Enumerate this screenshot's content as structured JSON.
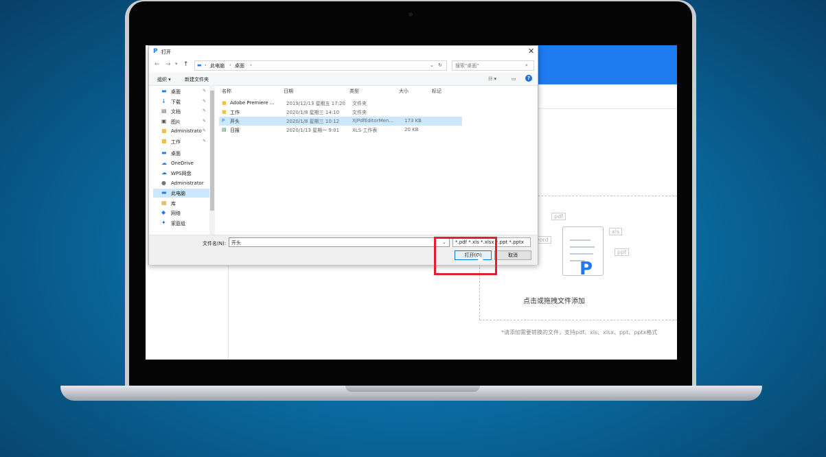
{
  "dialog": {
    "title": "打开",
    "breadcrumb": [
      "此电脑",
      "桌面"
    ],
    "search_placeholder": "搜索\"桌面\"",
    "commands": {
      "organize": "组织 ▾",
      "new_folder": "新建文件夹"
    },
    "nav_items": [
      {
        "icon": "desktop-icon",
        "label": "桌面",
        "pinned": true
      },
      {
        "icon": "download-icon",
        "label": "下载",
        "pinned": true
      },
      {
        "icon": "document-icon",
        "label": "文档",
        "pinned": true
      },
      {
        "icon": "image-icon",
        "label": "图片",
        "pinned": true
      },
      {
        "icon": "folder-icon",
        "label": "Administrato",
        "pinned": true
      },
      {
        "icon": "folder-icon",
        "label": "工作",
        "pinned": true
      },
      {
        "icon": "desktop-icon",
        "label": "桌面",
        "pinned": false
      },
      {
        "icon": "cloud-icon",
        "label": "OneDrive",
        "pinned": false
      },
      {
        "icon": "cloud-icon",
        "label": "WPS网盘",
        "pinned": false
      },
      {
        "icon": "user-icon",
        "label": "Administrator",
        "pinned": false
      },
      {
        "icon": "computer-icon",
        "label": "此电脑",
        "pinned": false
      },
      {
        "icon": "library-icon",
        "label": "库",
        "pinned": false
      },
      {
        "icon": "network-icon",
        "label": "网络",
        "pinned": false
      },
      {
        "icon": "homegroup-icon",
        "label": "家庭组",
        "pinned": false
      }
    ],
    "columns": {
      "name": "名称",
      "date": "日期",
      "type": "类型",
      "size": "大小",
      "tags": "标记"
    },
    "files": [
      {
        "icon": "folder-icon",
        "name": "Adobe Premiere ...",
        "date": "2019/12/13 星期五 17:20",
        "type": "文件夹",
        "size": ""
      },
      {
        "icon": "folder-icon",
        "name": "工作",
        "date": "2020/1/8 星期三 14:10",
        "type": "文件夹",
        "size": ""
      },
      {
        "icon": "pdf-icon",
        "name": "开头",
        "date": "2020/1/8 星期三 10:12",
        "type": "XjPdfEditorMen...",
        "size": "173 KB",
        "selected": true
      },
      {
        "icon": "xls-icon",
        "name": "日报",
        "date": "2020/1/13 星期一 9:01",
        "type": "XLS 工作表",
        "size": "20 KB"
      }
    ],
    "filename_label": "文件名(N):",
    "filename_value": "开头",
    "filetype_value": "*.pdf *.xls *.xlsx *.ppt *.pptx",
    "open_label": "打开(O)",
    "cancel_label": "取消"
  },
  "app": {
    "drop_text": "点击或拖拽文件添加",
    "support_text": "*请添加需要转换的文件，支持pdf、xls、xlsx、ppt、pptx格式",
    "tags": [
      "pdf",
      "xls",
      "word",
      "ppt"
    ],
    "brand_color": "#1f7bf0"
  },
  "annotation": {
    "highlight_color": "#e0202a"
  }
}
